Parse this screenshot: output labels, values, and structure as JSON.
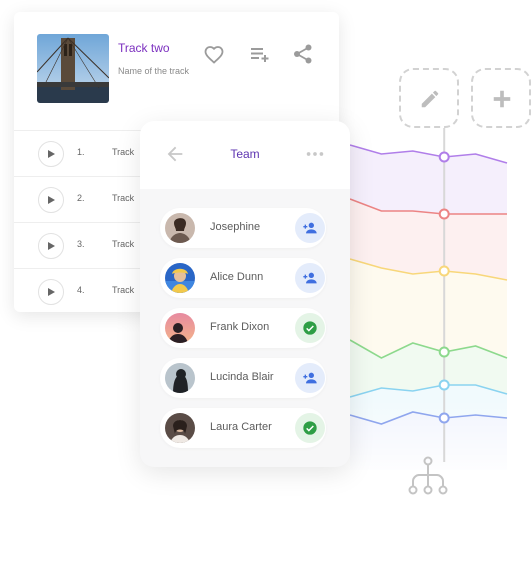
{
  "now_playing": {
    "title": "Track two",
    "subtitle": "Name of the track",
    "icons": [
      "heart-icon",
      "playlist-add-icon",
      "share-icon"
    ]
  },
  "tracks": [
    {
      "number": "1.",
      "title": "Track"
    },
    {
      "number": "2.",
      "title": "Track"
    },
    {
      "number": "3.",
      "title": "Track"
    },
    {
      "number": "4.",
      "title": "Track"
    }
  ],
  "team": {
    "title": "Team",
    "members": [
      {
        "name": "Josephine",
        "action": "add-person"
      },
      {
        "name": "Alice Dunn",
        "action": "add-person"
      },
      {
        "name": "Frank Dixon",
        "action": "check"
      },
      {
        "name": "Lucinda Blair",
        "action": "add-person"
      },
      {
        "name": "Laura Carter",
        "action": "check"
      }
    ]
  },
  "toolbar": {
    "buttons": [
      "pencil-icon",
      "plus-icon"
    ]
  },
  "colors": {
    "accent_purple": "#7b2fbf",
    "team_title": "#5e35b1",
    "add_bg": "#e4ecfb",
    "add_fg": "#3f6fe0",
    "done_bg": "#e4f4e6",
    "done_fg": "#2e9e45"
  },
  "chart_data": {
    "type": "line",
    "x": [
      0,
      1,
      2,
      3,
      4,
      5
    ],
    "series": [
      {
        "color": "#b07ee9",
        "values": [
          95,
          92,
          93,
          91,
          92,
          89
        ]
      },
      {
        "color": "#ec8484",
        "values": [
          77,
          73,
          73,
          72,
          72,
          72
        ]
      },
      {
        "color": "#f8d77a",
        "values": [
          57,
          54,
          52,
          53,
          52,
          50
        ]
      },
      {
        "color": "#8dd98d",
        "values": [
          30,
          24,
          29,
          26,
          28,
          24
        ]
      },
      {
        "color": "#8ad3f0",
        "values": [
          11,
          14,
          13,
          15,
          15,
          12
        ]
      },
      {
        "color": "#8fa6ee",
        "values": [
          5,
          2,
          6,
          4,
          5,
          4
        ]
      }
    ],
    "highlight_x": 3,
    "ylim": [
      0,
      100
    ]
  }
}
